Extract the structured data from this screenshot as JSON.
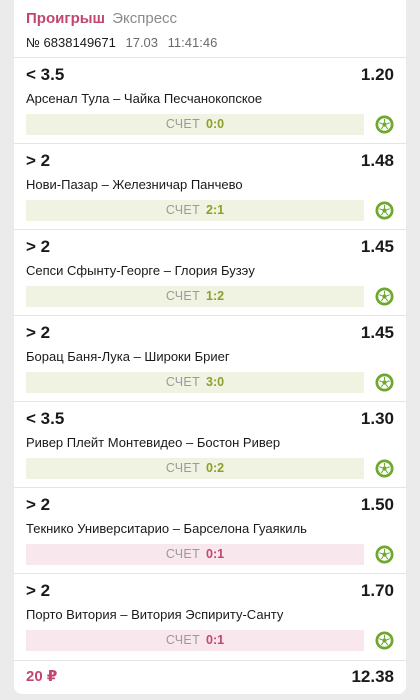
{
  "header": {
    "status": "Проигрыш",
    "bet_type": "Экспресс",
    "ticket_number": "№ 6838149671",
    "date": "17.03",
    "time": "11:41:46"
  },
  "score_label": "СЧЕТ",
  "events": [
    {
      "outcome": "< 3.5",
      "odds": "1.20",
      "teams": "Арсенал Тула – Чайка Песчанокопское",
      "score": "0:0",
      "result": "won"
    },
    {
      "outcome": "> 2",
      "odds": "1.48",
      "teams": "Нови-Пазар – Железничар Панчево",
      "score": "2:1",
      "result": "won"
    },
    {
      "outcome": "> 2",
      "odds": "1.45",
      "teams": "Сепси Сфынту-Георге – Глория Бузэу",
      "score": "1:2",
      "result": "won"
    },
    {
      "outcome": "> 2",
      "odds": "1.45",
      "teams": "Борац Баня-Лука – Широки Бриег",
      "score": "3:0",
      "result": "won"
    },
    {
      "outcome": "< 3.5",
      "odds": "1.30",
      "teams": "Ривер Плейт Монтевидео – Бостон Ривер",
      "score": "0:2",
      "result": "won"
    },
    {
      "outcome": "> 2",
      "odds": "1.50",
      "teams": "Текнико Университарио – Барселона Гуаякиль",
      "score": "0:1",
      "result": "lost"
    },
    {
      "outcome": "> 2",
      "odds": "1.70",
      "teams": "Порто Витория – Витория Эспириту-Санту",
      "score": "0:1",
      "result": "lost"
    }
  ],
  "footer": {
    "stake": "20 ₽",
    "total_odds": "12.38"
  },
  "icons": {
    "sport": "football-icon"
  },
  "colors": {
    "lost": "#c2466e",
    "won_score": "#8ba02a",
    "won_bg": "#f1f3e2",
    "lost_bg": "#f8e8ee",
    "sport_icon": "#6ea82e"
  }
}
